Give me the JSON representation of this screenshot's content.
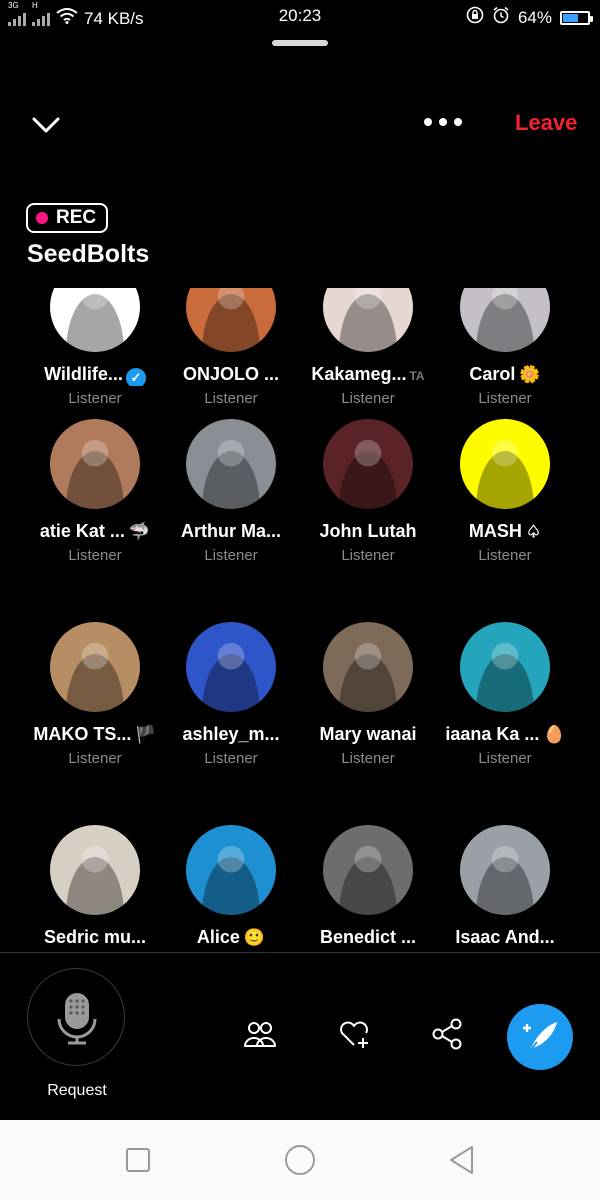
{
  "status_bar": {
    "network_1": "3G",
    "network_2": "H",
    "speed": "74 KB/s",
    "time": "20:23",
    "battery": "64%",
    "battery_level": 0.64
  },
  "header": {
    "leave_label": "Leave"
  },
  "room": {
    "rec_label": "REC",
    "title": "SeedBolts"
  },
  "participants": [
    {
      "name": "Wildlife...",
      "role": "Listener",
      "verified": true,
      "color": "#ffffff"
    },
    {
      "name": "ONJOLO ...",
      "role": "Listener",
      "color": "#c96b3a"
    },
    {
      "name": "Kakameg...",
      "badge": "TA",
      "role": "Listener",
      "color": "#e7d7d2"
    },
    {
      "name": "Carol",
      "emoji": "🌼",
      "role": "Listener",
      "color": "#c5c0c8"
    },
    {
      "name": "atie Kat ...",
      "emoji": "🦈",
      "role": "Listener",
      "color": "#b07a5c"
    },
    {
      "name": "Arthur Ma...",
      "role": "Listener",
      "color": "#8a8f95"
    },
    {
      "name": "John Lutah",
      "role": "Listener",
      "color": "#5a2328"
    },
    {
      "name": "MASH",
      "emoji": "♤",
      "role": "Listener",
      "color": "#fffc00"
    },
    {
      "name": "MAKO TS...",
      "emoji": "🏴",
      "role": "Listener",
      "color": "#b78d64"
    },
    {
      "name": "ashley_m...",
      "role": "Listener",
      "color": "#2f56c9"
    },
    {
      "name": "Mary wanai",
      "role": "Listener",
      "color": "#7d6a58"
    },
    {
      "name": "iaana Ka ...",
      "emoji": "🥚",
      "role": "Listener",
      "color": "#25a5bb"
    },
    {
      "name": "Sedric mu...",
      "role": "",
      "color": "#d8cfc4"
    },
    {
      "name": "Alice",
      "emoji": "🙂",
      "role": "",
      "color": "#1e8fd0"
    },
    {
      "name": "Benedict ...",
      "role": "",
      "color": "#6d6d6d"
    },
    {
      "name": "Isaac And...",
      "role": "",
      "color": "#9aa0a6"
    }
  ],
  "bottom": {
    "request_label": "Request"
  },
  "colors": {
    "accent": "#1d9bf0",
    "leave": "#f4212e",
    "rec_dot": "#f91880"
  }
}
